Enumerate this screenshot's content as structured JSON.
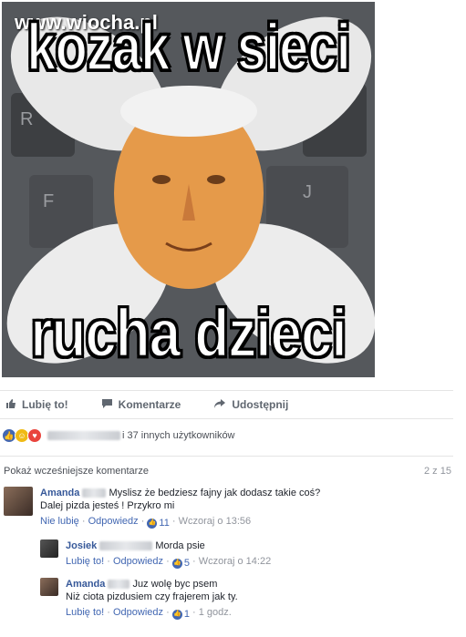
{
  "post": {
    "watermark": "www.wiocha.pl",
    "meme_top": "kozak w sieci",
    "meme_bottom": "rucha dzieci"
  },
  "actions": {
    "like": "Lubię to!",
    "comment": "Komentarze",
    "share": "Udostępnij"
  },
  "reactions": {
    "summary": "i 37 innych użytkowników"
  },
  "comments_header": {
    "show_previous": "Pokaż wcześniejsze komentarze",
    "count": "2 z 15"
  },
  "comments": [
    {
      "name": "Amanda",
      "text1": "Myslisz że bedziesz fajny jak dodasz takie coś?",
      "text2": "Dalej pizda jesteś ! Przykro mi",
      "like_label": "Nie lubię",
      "reply_label": "Odpowiedz",
      "likes": "11",
      "time": "Wczoraj o 13:56"
    },
    {
      "name": "Josiek",
      "text1": "Morda psie",
      "like_label": "Lubię to!",
      "reply_label": "Odpowiedz",
      "likes": "5",
      "time": "Wczoraj o 14:22"
    },
    {
      "name": "Amanda",
      "text1": "Juz wolę byc psem",
      "text2": "Niż ciota pizdusiem czy frajerem jak ty.",
      "like_label": "Lubię to!",
      "reply_label": "Odpowiedz",
      "likes": "1",
      "time": "1 godz."
    }
  ],
  "colors": {
    "link": "#365899",
    "accent": "#4267b2",
    "muted": "#90949c"
  }
}
